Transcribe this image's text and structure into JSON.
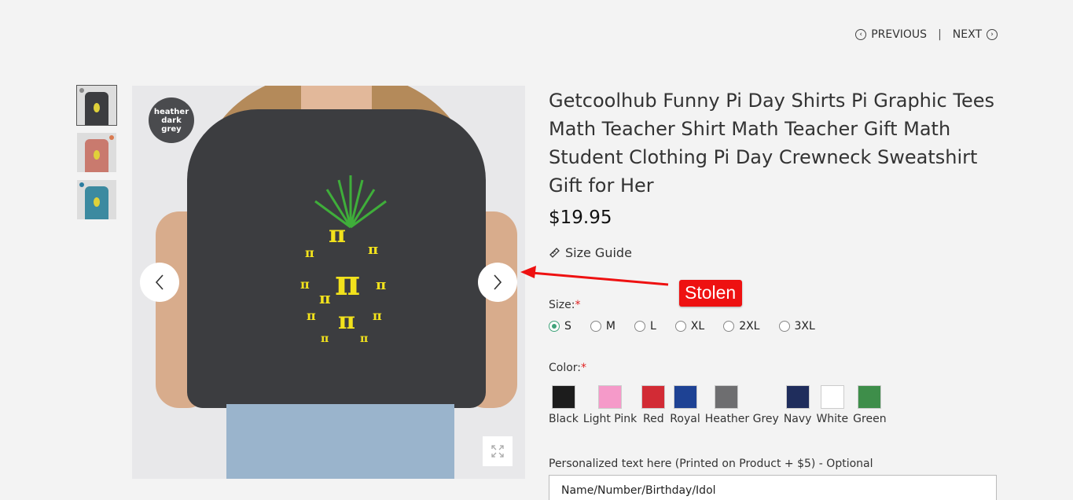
{
  "pager": {
    "previous": "PREVIOUS",
    "separator": "|",
    "next": "NEXT"
  },
  "thumbnails": [
    {
      "shirt_color": "#3c3d40",
      "dot_color": "#888888",
      "active": true
    },
    {
      "shirt_color": "#c97a6e",
      "dot_color": "#d97a50",
      "active": false
    },
    {
      "shirt_color": "#3c8aa0",
      "dot_color": "#2a7ca0",
      "active": false
    }
  ],
  "main_image": {
    "badge": [
      "heather",
      "dark",
      "grey"
    ],
    "shirt_color": "#3c3d40",
    "print_color": "#f2e21c",
    "print_glyph": "π"
  },
  "product": {
    "title": "Getcoolhub Funny Pi Day Shirts Pi Graphic Tees Math Teacher Shirt Math Teacher Gift Math Student Clothing Pi Day Crewneck Sweatshirt Gift for Her",
    "price": "$19.95",
    "size_guide": "Size Guide",
    "size_label": "Size:",
    "required_mark": "*",
    "sizes": [
      {
        "label": "S",
        "selected": true
      },
      {
        "label": "M",
        "selected": false
      },
      {
        "label": "L",
        "selected": false
      },
      {
        "label": "XL",
        "selected": false
      },
      {
        "label": "2XL",
        "selected": false
      },
      {
        "label": "3XL",
        "selected": false
      }
    ],
    "color_label": "Color:",
    "colors": [
      {
        "name": "Black",
        "hex": "#1c1c1c"
      },
      {
        "name": "Light Pink",
        "hex": "#f59ac9"
      },
      {
        "name": "Red",
        "hex": "#d22b35"
      },
      {
        "name": "Royal",
        "hex": "#1e4294"
      },
      {
        "name": "Heather Grey",
        "hex": "#6e6e70"
      },
      {
        "name": "Navy",
        "hex": "#1f2d5c"
      },
      {
        "name": "White",
        "hex": "#ffffff"
      },
      {
        "name": "Green",
        "hex": "#3e8e4a"
      }
    ],
    "personalized_label": "Personalized text here (Printed on Product + $5) - Optional",
    "personalized_value": "Name/Number/Birthday/Idol"
  },
  "annotation": {
    "label": "Stolen",
    "color": "#ee1111"
  }
}
